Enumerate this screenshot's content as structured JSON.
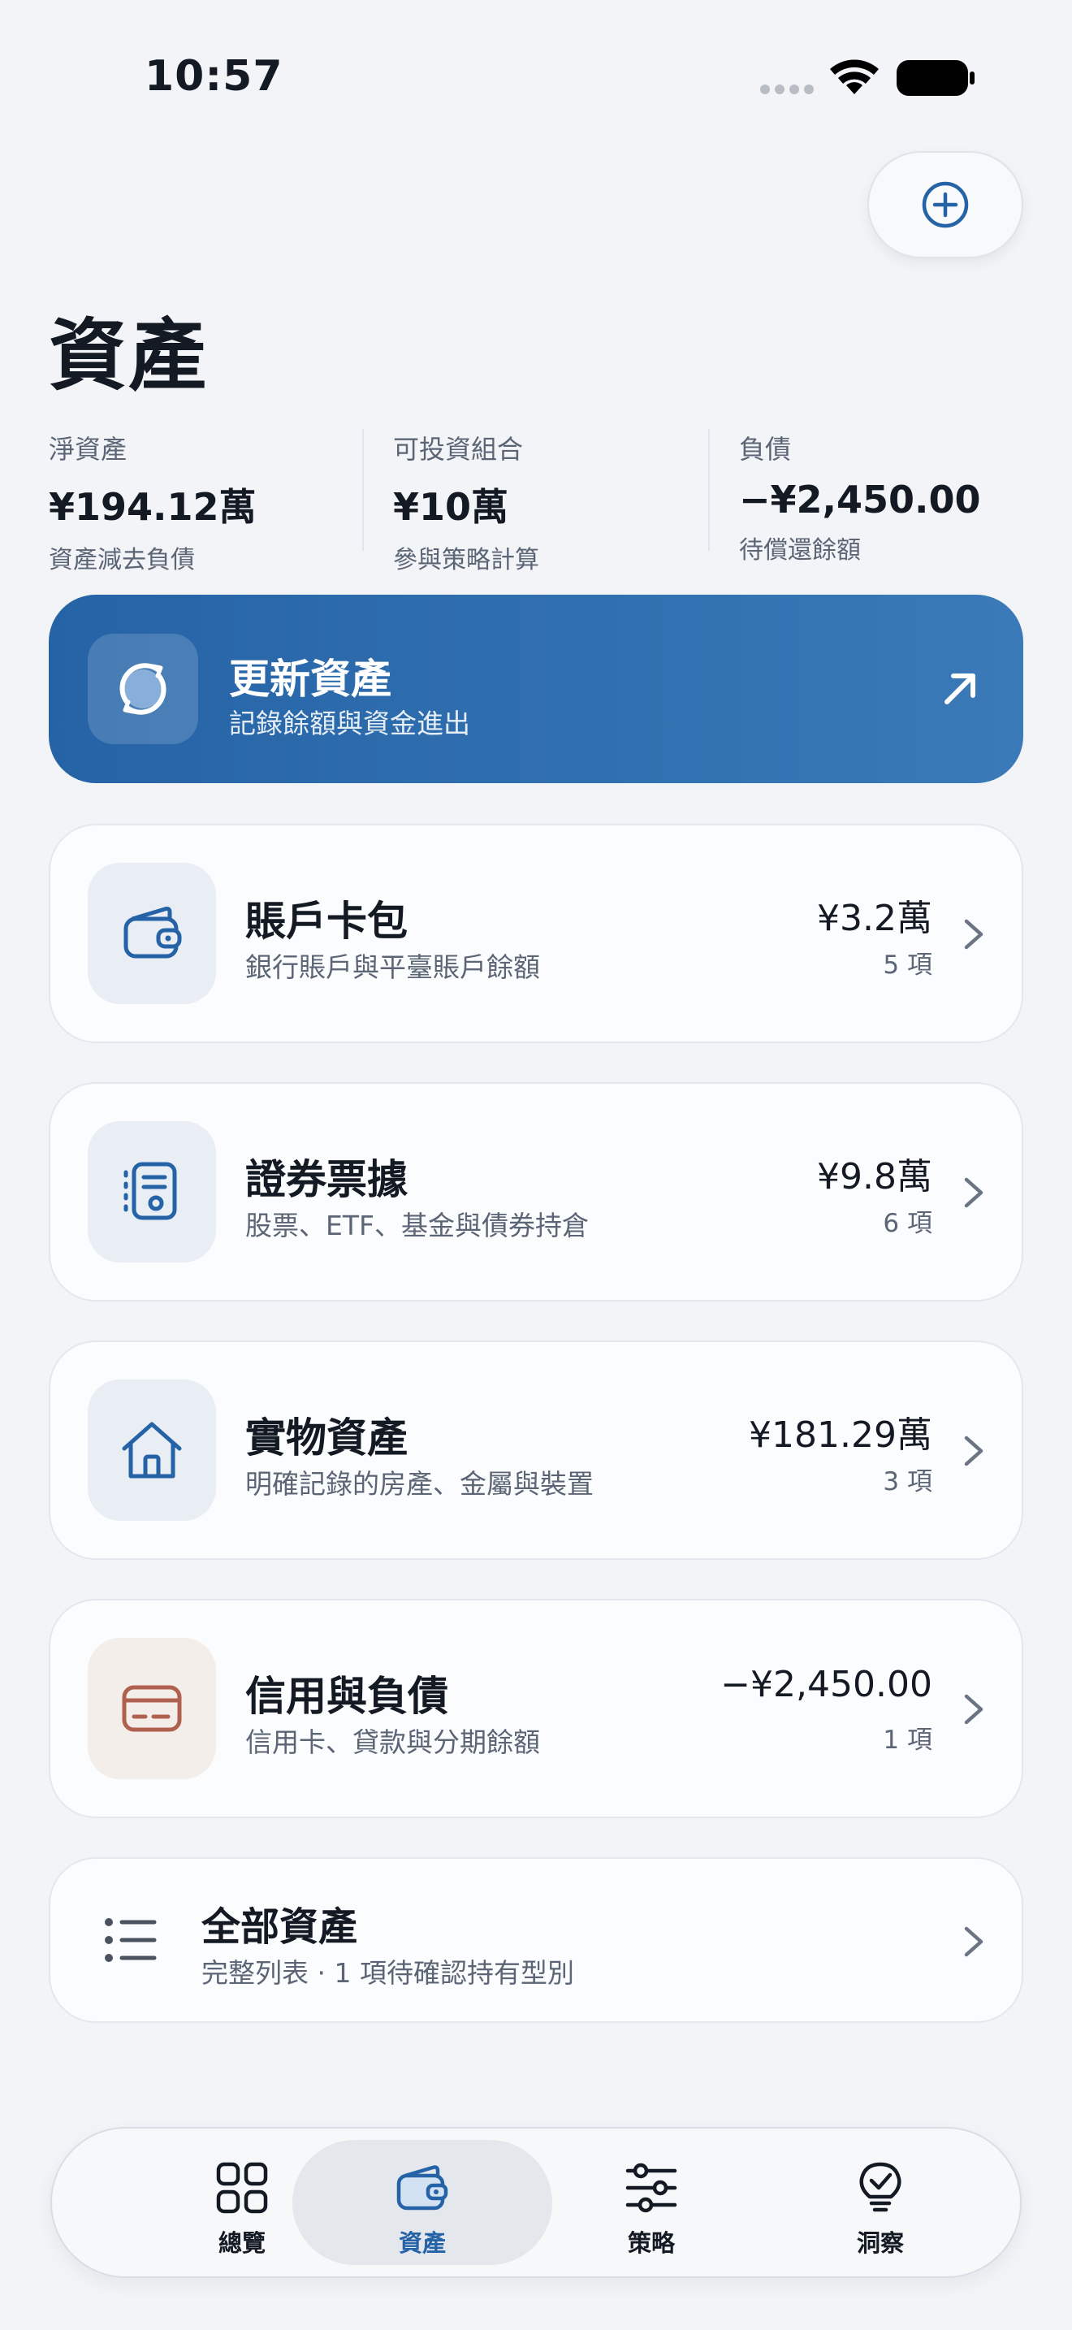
{
  "status_bar": {
    "time": "10:57"
  },
  "header": {
    "title": "資產"
  },
  "summary": [
    {
      "label": "淨資產",
      "value": "¥194.12萬",
      "note": "資產減去負債"
    },
    {
      "label": "可投資組合",
      "value": "¥10萬",
      "note": "參與策略計算"
    },
    {
      "label": "負債",
      "value": "−¥2,450.00",
      "note": "待償還餘額"
    }
  ],
  "update_card": {
    "title": "更新資產",
    "subtitle": "記錄餘額與資金進出"
  },
  "categories": [
    {
      "title": "賬戶卡包",
      "subtitle": "銀行賬戶與平臺賬戶餘額",
      "amount": "¥3.2萬",
      "count": "5 項",
      "icon": "wallet-icon"
    },
    {
      "title": "證券票據",
      "subtitle": "股票、ETF、基金與債券持倉",
      "amount": "¥9.8萬",
      "count": "6 項",
      "icon": "document-icon"
    },
    {
      "title": "實物資產",
      "subtitle": "明確記錄的房產、金屬與裝置",
      "amount": "¥181.29萬",
      "count": "3 項",
      "icon": "house-icon"
    },
    {
      "title": "信用與負債",
      "subtitle": "信用卡、貸款與分期餘額",
      "amount": "−¥2,450.00",
      "count": "1 項",
      "icon": "credit-card-icon"
    }
  ],
  "all_assets": {
    "title": "全部資產",
    "subtitle": "完整列表 · 1 項待確認持有型別"
  },
  "tabs": [
    {
      "label": "總覽",
      "icon": "grid-icon"
    },
    {
      "label": "資產",
      "icon": "wallet-icon"
    },
    {
      "label": "策略",
      "icon": "sliders-icon"
    },
    {
      "label": "洞察",
      "icon": "lightbulb-icon"
    }
  ],
  "colors": {
    "accent": "#2563a6",
    "debt_icon": "#b0604f",
    "text_secondary": "#5b6575"
  }
}
